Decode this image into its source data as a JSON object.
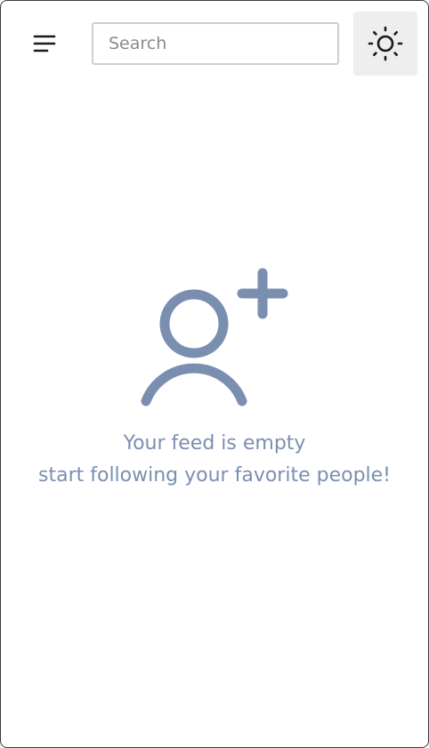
{
  "header": {
    "menu_icon": "menu-icon",
    "search_placeholder": "Search",
    "search_value": "",
    "theme_icon": "sun-icon"
  },
  "empty_state": {
    "icon": "user-plus-icon",
    "title": "Your feed is empty",
    "subtitle": "start following your favorite people!"
  },
  "colors": {
    "accent": "#7a8fb0",
    "icon_dark": "#1a1a1a",
    "theme_button_bg": "#eeeeee",
    "input_border": "#cfcfcf"
  }
}
